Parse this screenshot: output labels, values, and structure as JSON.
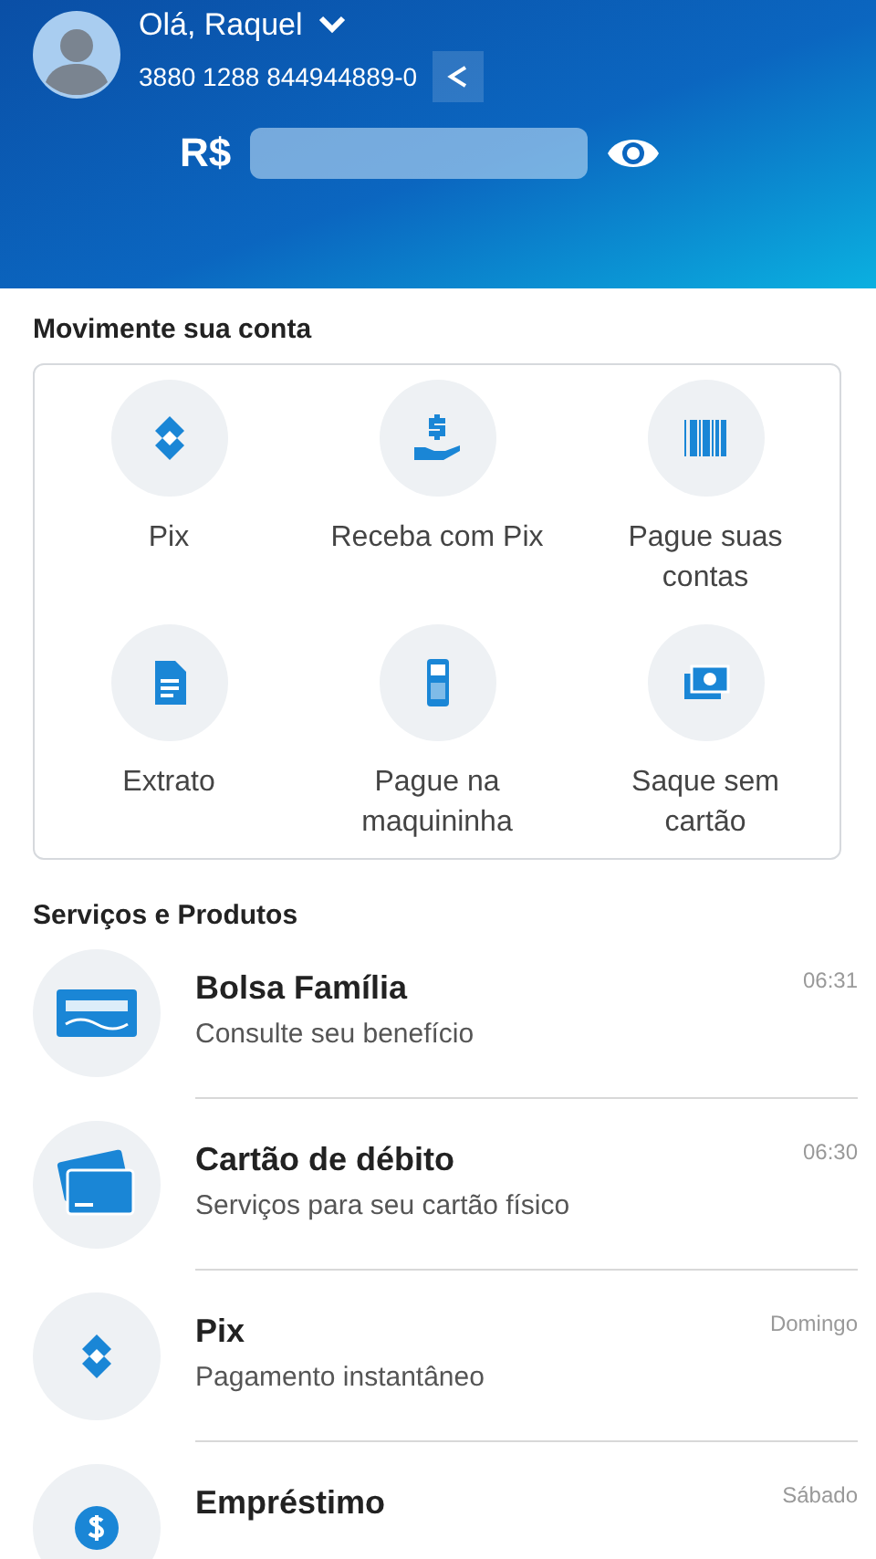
{
  "header": {
    "greeting": "Olá, Raquel",
    "account": "3880 1288 844944889-0",
    "balance": {
      "currency": "R$",
      "hidden": true
    }
  },
  "account_section": {
    "title": "Movimente sua conta",
    "actions": [
      {
        "kind": "pix",
        "label": "Pix"
      },
      {
        "kind": "receive",
        "label": "Receba com Pix"
      },
      {
        "kind": "barcode",
        "label": "Pague suas contas"
      },
      {
        "kind": "statement",
        "label": "Extrato"
      },
      {
        "kind": "pos",
        "label": "Pague na maquininha"
      },
      {
        "kind": "cash",
        "label": "Saque sem cartão"
      }
    ]
  },
  "services": {
    "title": "Serviços e Produtos",
    "items": [
      {
        "kind": "bolsa",
        "title": "Bolsa Família",
        "subtitle": "Consulte seu benefício",
        "time": "06:31"
      },
      {
        "kind": "card",
        "title": "Cartão de débito",
        "subtitle": "Serviços para seu cartão físico",
        "time": "06:30"
      },
      {
        "kind": "pix",
        "title": "Pix",
        "subtitle": "Pagamento instantâneo",
        "time": "Domingo"
      },
      {
        "kind": "loan",
        "title": "Empréstimo",
        "time": "Sábado"
      }
    ]
  }
}
